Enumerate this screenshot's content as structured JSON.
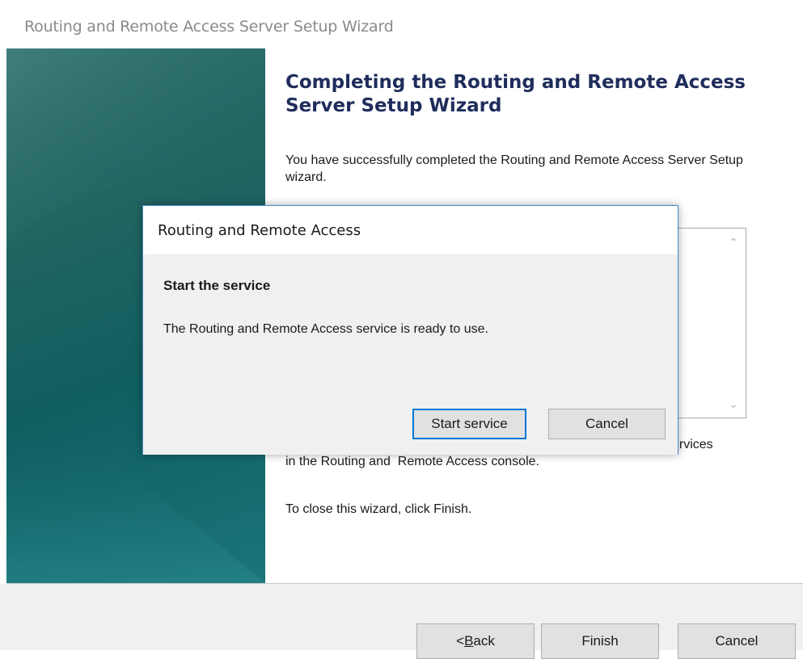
{
  "window": {
    "title": "Routing and Remote Access Server Setup Wizard"
  },
  "wizard": {
    "heading": "Completing the Routing and Remote Access Server Setup Wizard",
    "description": "You have successfully completed the Routing and Remote Access Server Setup wizard.",
    "manage_text_visible": "ervices in the Routing and  Remote Access console.",
    "close_text": "To close this wizard, click Finish."
  },
  "footer": {
    "back_prefix": "< ",
    "back_underline": "B",
    "back_rest": "ack",
    "finish_label": "Finish",
    "cancel_label": "Cancel"
  },
  "dialog": {
    "title": "Routing and Remote Access",
    "heading": "Start the service",
    "message": "The Routing and Remote Access service is ready to use.",
    "start_label": "Start service",
    "cancel_label": "Cancel"
  },
  "colors": {
    "banner_accent": "#0f5e60",
    "heading_color": "#1f2d5c",
    "dialog_border": "#4a89c8",
    "focus_border": "#0078d7"
  }
}
